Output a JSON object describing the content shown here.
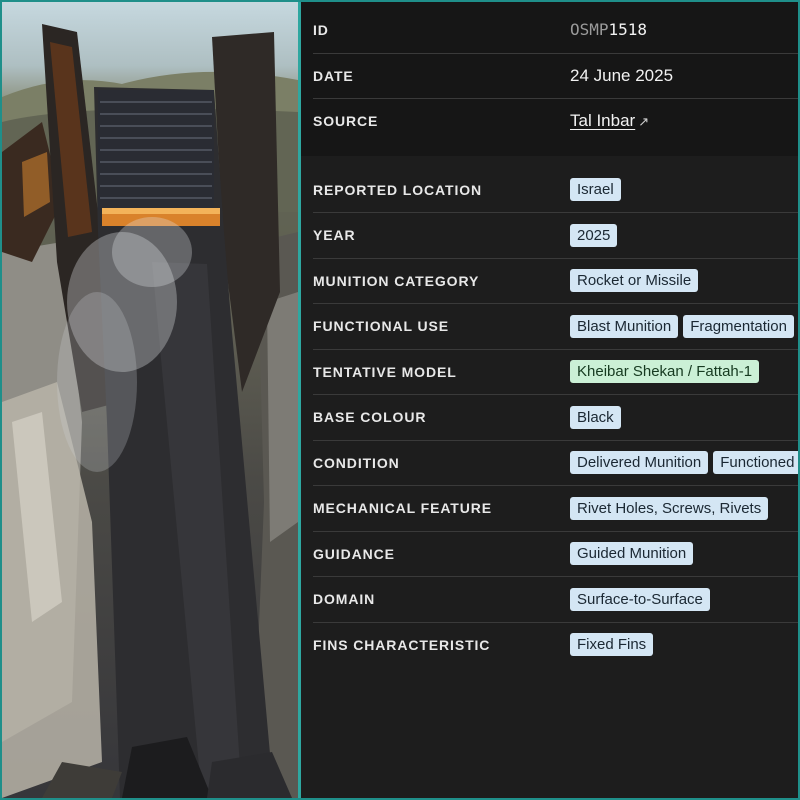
{
  "record": {
    "id_prefix": "OSMP",
    "id_number": "1518",
    "rows_meta": [
      {
        "label": "ID"
      },
      {
        "label": "DATE",
        "value": "24 June 2025"
      },
      {
        "label": "SOURCE",
        "value": "Tal Inbar",
        "link_icon": "external-link-icon"
      }
    ],
    "attributes": [
      {
        "label": "REPORTED LOCATION",
        "tags": [
          "Israel"
        ]
      },
      {
        "label": "YEAR",
        "tags": [
          "2025"
        ]
      },
      {
        "label": "MUNITION CATEGORY",
        "tags": [
          "Rocket or Missile"
        ]
      },
      {
        "label": "FUNCTIONAL USE",
        "tags": [
          "Blast Munition",
          "Fragmentation"
        ]
      },
      {
        "label": "TENTATIVE MODEL",
        "tags": [
          "Kheibar Shekan / Fattah-1"
        ],
        "tag_style": "green"
      },
      {
        "label": "BASE COLOUR",
        "tags": [
          "Black"
        ]
      },
      {
        "label": "CONDITION",
        "tags": [
          "Delivered Munition",
          "Functioned"
        ]
      },
      {
        "label": "MECHANICAL FEATURE",
        "tags": [
          "Rivet Holes, Screws, Rivets"
        ]
      },
      {
        "label": "GUIDANCE",
        "tags": [
          "Guided Munition"
        ]
      },
      {
        "label": "DOMAIN",
        "tags": [
          "Surface-to-Surface"
        ]
      },
      {
        "label": "FINS CHARACTERISTIC",
        "tags": [
          "Fixed Fins"
        ]
      }
    ]
  },
  "colors": {
    "frame_border": "#1f8f8a",
    "panel_bg": "#1d1d1d",
    "meta_bg": "#161616",
    "tag_blue": "#d4e6f4",
    "tag_green": "#cbf0d6"
  }
}
